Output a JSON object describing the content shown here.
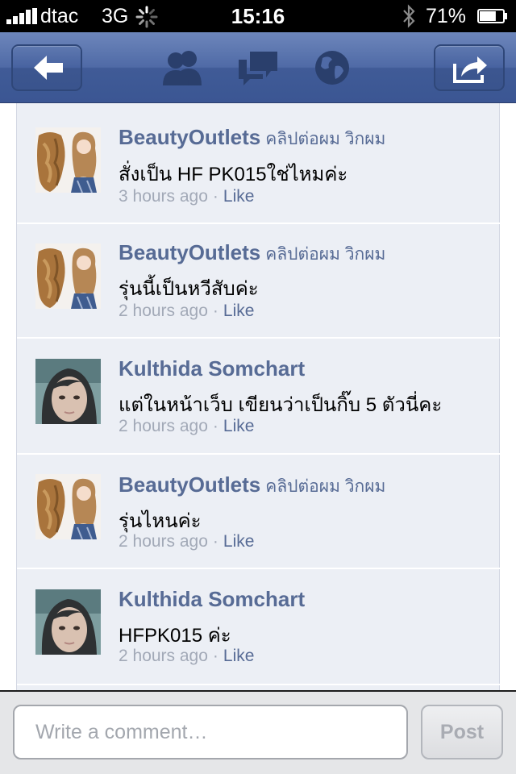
{
  "status_bar": {
    "carrier": "dtac",
    "network": "3G",
    "time": "15:16",
    "battery": "71%",
    "battery_level": 0.71
  },
  "nav": {
    "icons": [
      "back-arrow-icon",
      "friends-icon",
      "messages-icon",
      "globe-icon",
      "share-icon"
    ]
  },
  "comments": [
    {
      "name": "BeautyOutlets",
      "page": "คลิปต่อผม วิกผม",
      "text": "สั่งเป็น HF PK015ใช่ไหมค่ะ",
      "time": "3 hours ago",
      "like": "Like",
      "avatar": "hair-product-avatar"
    },
    {
      "name": "BeautyOutlets",
      "page": "คลิปต่อผม วิกผม",
      "text": "รุ่นนี้เป็นหวีสับค่ะ",
      "time": "2 hours ago",
      "like": "Like",
      "avatar": "hair-product-avatar"
    },
    {
      "name": "Kulthida Somchart",
      "page": "",
      "text": "แต่ในหน้าเว็บ เขียนว่าเป็นกิ๊บ 5 ตัวนี่คะ",
      "time": "2 hours ago",
      "like": "Like",
      "avatar": "user-photo-avatar"
    },
    {
      "name": "BeautyOutlets",
      "page": "คลิปต่อผม วิกผม",
      "text": "รุ่นไหนค่ะ",
      "time": "2 hours ago",
      "like": "Like",
      "avatar": "hair-product-avatar"
    },
    {
      "name": "Kulthida Somchart",
      "page": "",
      "text": "HFPK015 ค่ะ",
      "time": "2 hours ago",
      "like": "Like",
      "avatar": "user-photo-avatar"
    }
  ],
  "compose": {
    "placeholder": "Write a comment…",
    "value": "",
    "post_label": "Post"
  },
  "colors": {
    "nav_blue": "#3b5998",
    "link_blue": "#576b95",
    "panel_bg": "#eceff5",
    "timestamp_gray": "#a2a9b7"
  }
}
